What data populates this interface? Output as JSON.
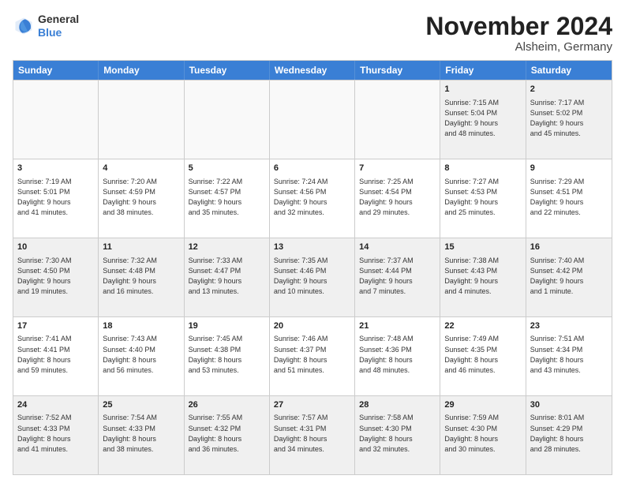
{
  "logo": {
    "general": "General",
    "blue": "Blue"
  },
  "title": "November 2024",
  "location": "Alsheim, Germany",
  "days": [
    "Sunday",
    "Monday",
    "Tuesday",
    "Wednesday",
    "Thursday",
    "Friday",
    "Saturday"
  ],
  "rows": [
    [
      {
        "day": "",
        "detail": ""
      },
      {
        "day": "",
        "detail": ""
      },
      {
        "day": "",
        "detail": ""
      },
      {
        "day": "",
        "detail": ""
      },
      {
        "day": "",
        "detail": ""
      },
      {
        "day": "1",
        "detail": "Sunrise: 7:15 AM\nSunset: 5:04 PM\nDaylight: 9 hours\nand 48 minutes."
      },
      {
        "day": "2",
        "detail": "Sunrise: 7:17 AM\nSunset: 5:02 PM\nDaylight: 9 hours\nand 45 minutes."
      }
    ],
    [
      {
        "day": "3",
        "detail": "Sunrise: 7:19 AM\nSunset: 5:01 PM\nDaylight: 9 hours\nand 41 minutes."
      },
      {
        "day": "4",
        "detail": "Sunrise: 7:20 AM\nSunset: 4:59 PM\nDaylight: 9 hours\nand 38 minutes."
      },
      {
        "day": "5",
        "detail": "Sunrise: 7:22 AM\nSunset: 4:57 PM\nDaylight: 9 hours\nand 35 minutes."
      },
      {
        "day": "6",
        "detail": "Sunrise: 7:24 AM\nSunset: 4:56 PM\nDaylight: 9 hours\nand 32 minutes."
      },
      {
        "day": "7",
        "detail": "Sunrise: 7:25 AM\nSunset: 4:54 PM\nDaylight: 9 hours\nand 29 minutes."
      },
      {
        "day": "8",
        "detail": "Sunrise: 7:27 AM\nSunset: 4:53 PM\nDaylight: 9 hours\nand 25 minutes."
      },
      {
        "day": "9",
        "detail": "Sunrise: 7:29 AM\nSunset: 4:51 PM\nDaylight: 9 hours\nand 22 minutes."
      }
    ],
    [
      {
        "day": "10",
        "detail": "Sunrise: 7:30 AM\nSunset: 4:50 PM\nDaylight: 9 hours\nand 19 minutes."
      },
      {
        "day": "11",
        "detail": "Sunrise: 7:32 AM\nSunset: 4:48 PM\nDaylight: 9 hours\nand 16 minutes."
      },
      {
        "day": "12",
        "detail": "Sunrise: 7:33 AM\nSunset: 4:47 PM\nDaylight: 9 hours\nand 13 minutes."
      },
      {
        "day": "13",
        "detail": "Sunrise: 7:35 AM\nSunset: 4:46 PM\nDaylight: 9 hours\nand 10 minutes."
      },
      {
        "day": "14",
        "detail": "Sunrise: 7:37 AM\nSunset: 4:44 PM\nDaylight: 9 hours\nand 7 minutes."
      },
      {
        "day": "15",
        "detail": "Sunrise: 7:38 AM\nSunset: 4:43 PM\nDaylight: 9 hours\nand 4 minutes."
      },
      {
        "day": "16",
        "detail": "Sunrise: 7:40 AM\nSunset: 4:42 PM\nDaylight: 9 hours\nand 1 minute."
      }
    ],
    [
      {
        "day": "17",
        "detail": "Sunrise: 7:41 AM\nSunset: 4:41 PM\nDaylight: 8 hours\nand 59 minutes."
      },
      {
        "day": "18",
        "detail": "Sunrise: 7:43 AM\nSunset: 4:40 PM\nDaylight: 8 hours\nand 56 minutes."
      },
      {
        "day": "19",
        "detail": "Sunrise: 7:45 AM\nSunset: 4:38 PM\nDaylight: 8 hours\nand 53 minutes."
      },
      {
        "day": "20",
        "detail": "Sunrise: 7:46 AM\nSunset: 4:37 PM\nDaylight: 8 hours\nand 51 minutes."
      },
      {
        "day": "21",
        "detail": "Sunrise: 7:48 AM\nSunset: 4:36 PM\nDaylight: 8 hours\nand 48 minutes."
      },
      {
        "day": "22",
        "detail": "Sunrise: 7:49 AM\nSunset: 4:35 PM\nDaylight: 8 hours\nand 46 minutes."
      },
      {
        "day": "23",
        "detail": "Sunrise: 7:51 AM\nSunset: 4:34 PM\nDaylight: 8 hours\nand 43 minutes."
      }
    ],
    [
      {
        "day": "24",
        "detail": "Sunrise: 7:52 AM\nSunset: 4:33 PM\nDaylight: 8 hours\nand 41 minutes."
      },
      {
        "day": "25",
        "detail": "Sunrise: 7:54 AM\nSunset: 4:33 PM\nDaylight: 8 hours\nand 38 minutes."
      },
      {
        "day": "26",
        "detail": "Sunrise: 7:55 AM\nSunset: 4:32 PM\nDaylight: 8 hours\nand 36 minutes."
      },
      {
        "day": "27",
        "detail": "Sunrise: 7:57 AM\nSunset: 4:31 PM\nDaylight: 8 hours\nand 34 minutes."
      },
      {
        "day": "28",
        "detail": "Sunrise: 7:58 AM\nSunset: 4:30 PM\nDaylight: 8 hours\nand 32 minutes."
      },
      {
        "day": "29",
        "detail": "Sunrise: 7:59 AM\nSunset: 4:30 PM\nDaylight: 8 hours\nand 30 minutes."
      },
      {
        "day": "30",
        "detail": "Sunrise: 8:01 AM\nSunset: 4:29 PM\nDaylight: 8 hours\nand 28 minutes."
      }
    ]
  ]
}
